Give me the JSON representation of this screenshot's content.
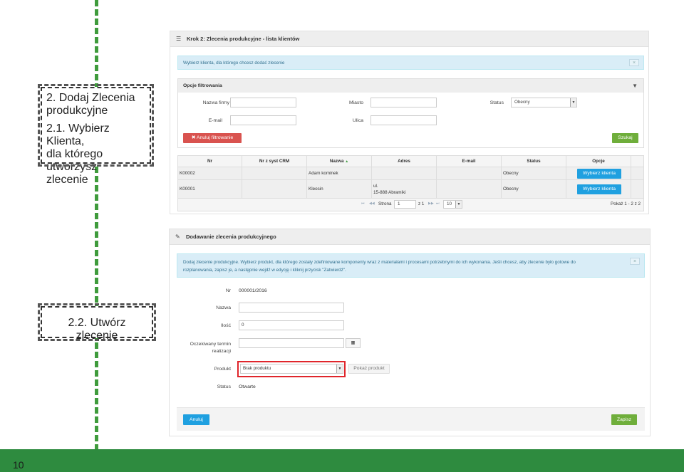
{
  "slide": {
    "page_number": "10"
  },
  "callouts": {
    "step1_lines": [
      "2. Dodaj Zlecenia",
      "produkcyjne"
    ],
    "step1b_lines": [
      "2.1. Wybierz Klienta,",
      "dla którego utworzysz",
      "zlecenie"
    ],
    "step2_label": "2.2. Utwórz zlecenie"
  },
  "panel1": {
    "title": "Krok 2: Zlecenia produkcyjne - lista klientów",
    "info": "Wybierz klienta, dla którego chcesz dodać zlecenie",
    "close": "×",
    "filter": {
      "title": "Opcje filtrowania",
      "toggle": "▼",
      "company_label": "Nazwa firmy",
      "email_label": "E-mail",
      "city_label": "Miasto",
      "street_label": "Ulica",
      "status_label": "Status",
      "status_value": "Obecny",
      "cancel_button": "✖ Anuluj filtrowanie",
      "search_button": "Szukaj"
    },
    "table": {
      "headers": [
        "Nr",
        "Nr z syst CRM",
        "Nazwa",
        "Adres",
        "E-mail",
        "Status",
        "Opcje"
      ],
      "sort_icon": "▲",
      "rows": [
        {
          "nr": "K00002",
          "crm": "",
          "name": "Adam kominek",
          "address1": "",
          "address2": "",
          "email": "",
          "status": "Obecny",
          "action": "Wybierz klienta"
        },
        {
          "nr": "K00001",
          "crm": "",
          "name": "Kleosin",
          "address1": "ul.",
          "address2": "15-888 Abramiki",
          "email": "",
          "status": "Obecny",
          "action": "Wybierz klienta"
        }
      ],
      "pager": {
        "first": "⏮",
        "prev": "◀◀",
        "page_label": "Strona",
        "page_value": "1",
        "of_label": "z 1",
        "next": "▶▶",
        "last": "⏭",
        "size_value": "10",
        "summary": "Pokaż 1 - 2 z 2"
      }
    }
  },
  "panel2": {
    "title": "Dodawanie zlecenia produkcyjnego",
    "info_line1": "Dodaj zlecenie produkcyjne. Wybierz produkt, dla którego zostały zdefiniowane komponenty wraz z materiałami i procesami potrzebnymi do ich wykonania. Jeśli chcesz, aby zlecenie było gotowe do",
    "info_line2": "rozplanowania, zapisz je, a następnie wejdź w edycję i kliknij przycisk \"Zatwierdź\".",
    "close": "×",
    "form": {
      "nr_label": "Nr",
      "nr_value": "000001/2016",
      "name_label": "Nazwa",
      "qty_label": "Ilość",
      "qty_value": "0",
      "date_label_1": "Oczekiwany termin",
      "date_label_2": "realizacji",
      "product_label": "Produkt",
      "product_value": "Brak produktu",
      "show_product_button": "Pokaż produkt",
      "status_label": "Status",
      "status_value": "Otwarte"
    },
    "cancel_button": "Anuluj",
    "save_button": "Zapisz"
  },
  "colors": {
    "accent_green": "#2e8b3f",
    "timeline": "#3f9b3c",
    "highlight_red": "#e0252b",
    "info_bg": "#d9edf7"
  }
}
